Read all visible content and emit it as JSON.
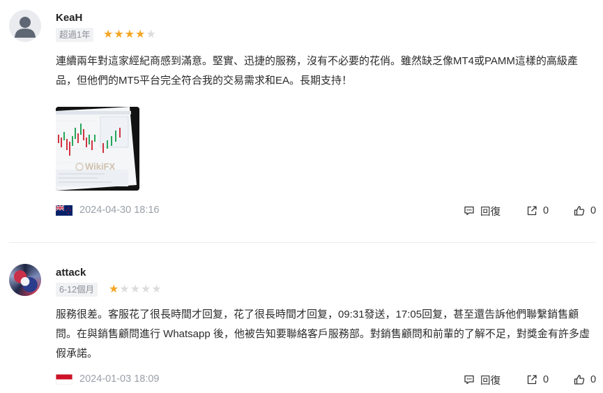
{
  "reviews": [
    {
      "username": "KeaH",
      "tenure": "超過1年",
      "rating": 4,
      "max_rating": 5,
      "text": "連續兩年對這家經紀商感到滿意。堅實、迅捷的服務，沒有不必要的花俏。雖然缺乏像MT4或PAMM這樣的高級產品，但他們的MT5平台完全符合我的交易需求和EA。長期支持！",
      "has_image": true,
      "image_watermark": "WikiFX",
      "flag": "new-zealand",
      "date": "2024-04-30 18:16",
      "reply_label": "回復",
      "share_count": "0",
      "like_count": "0"
    },
    {
      "username": "attack",
      "tenure": "6-12個月",
      "rating": 1,
      "max_rating": 5,
      "text": "服務很差。客服花了很長時間才回复，花了很長時間才回复，09:31發送，17:05回复，甚至還告訴他們聯繫銷售顧問。在與銷售顧問進行 Whatsapp 後，他被告知要聯絡客戶服務部。對銷售顧問和前輩的了解不足，對獎金有許多虛假承諾。",
      "has_image": false,
      "flag": "indonesia",
      "date": "2024-01-03 18:09",
      "reply_label": "回復",
      "share_count": "0",
      "like_count": "0"
    }
  ],
  "colors": {
    "star_on": "#f5a623",
    "star_off": "#dcdcdc",
    "date_text": "#9aa0a8",
    "badge_bg": "#f1f2f4"
  }
}
